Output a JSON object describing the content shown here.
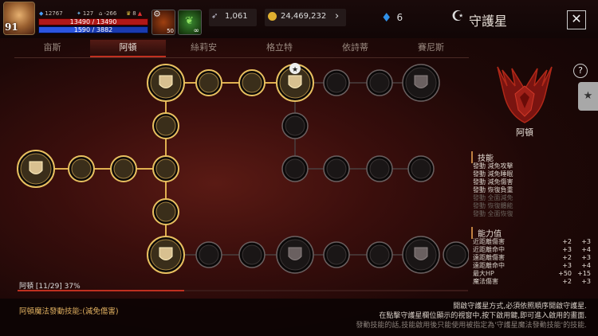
{
  "player": {
    "level": "91",
    "stat_a": "12767",
    "stat_b": "127",
    "stat_c": "-266",
    "stat_d": "8",
    "hp": "13490 / 13490",
    "mp": "1590 / 3882",
    "hp_fraction": 1.0,
    "mp_fraction": 0.41,
    "item_count": "50",
    "item_inf": "∞"
  },
  "currency": {
    "feather": "1,061",
    "gold": "24,469,232",
    "gems": "6"
  },
  "window": {
    "title": "守護星",
    "close": "✕"
  },
  "tabs": [
    {
      "label": "亩斯",
      "active": false
    },
    {
      "label": "阿頓",
      "active": true
    },
    {
      "label": "絲莉安",
      "active": false
    },
    {
      "label": "格立特",
      "active": false
    },
    {
      "label": "依詩蒂",
      "active": false
    },
    {
      "label": "賽尼斯",
      "active": false
    }
  ],
  "guardian": {
    "name": "阿頓",
    "help": "?",
    "skills_header": "技能",
    "skills": [
      {
        "text": "發動 減免攻擊",
        "active": true
      },
      {
        "text": "發動 減免睡眠",
        "active": true
      },
      {
        "text": "發動 減免傷害",
        "active": true
      },
      {
        "text": "發動 恢復負重",
        "active": true
      },
      {
        "text": "發動 全面減免",
        "active": false
      },
      {
        "text": "發動 恢復體能",
        "active": false
      },
      {
        "text": "發動 全面恢復",
        "active": false
      }
    ],
    "stats_header": "能力值",
    "stats": [
      {
        "name": "近距離傷害",
        "cur": "+2",
        "next": "+3"
      },
      {
        "name": "近距離命中",
        "cur": "+3",
        "next": "+4"
      },
      {
        "name": "遠距離傷害",
        "cur": "+2",
        "next": "+3"
      },
      {
        "name": "遠距離命中",
        "cur": "+3",
        "next": "+4"
      },
      {
        "name": "最大HP",
        "cur": "+50",
        "next": "+15"
      },
      {
        "name": "魔法傷害",
        "cur": "+2",
        "next": "+3"
      }
    ]
  },
  "progress": {
    "label": "阿頓 [11/29] 37%",
    "fraction": 0.37
  },
  "footer": {
    "left": "阿頓魔法發動技能:(減免傷害)",
    "line1": "開啟守護星方式,必須依照順序開啟守護星.",
    "line2": "在點擊守護星欄位顯示的視窗中,按下啟用鍵,即可進入啟用的畫面.",
    "line3": "發動技能的話,技能啟用後只能使用被指定為'守護星魔法發動技能'的技能."
  },
  "colors": {
    "accent": "#c03020",
    "gold": "#e0b060",
    "node_lit": "#d4a040",
    "node_dim": "#555"
  }
}
